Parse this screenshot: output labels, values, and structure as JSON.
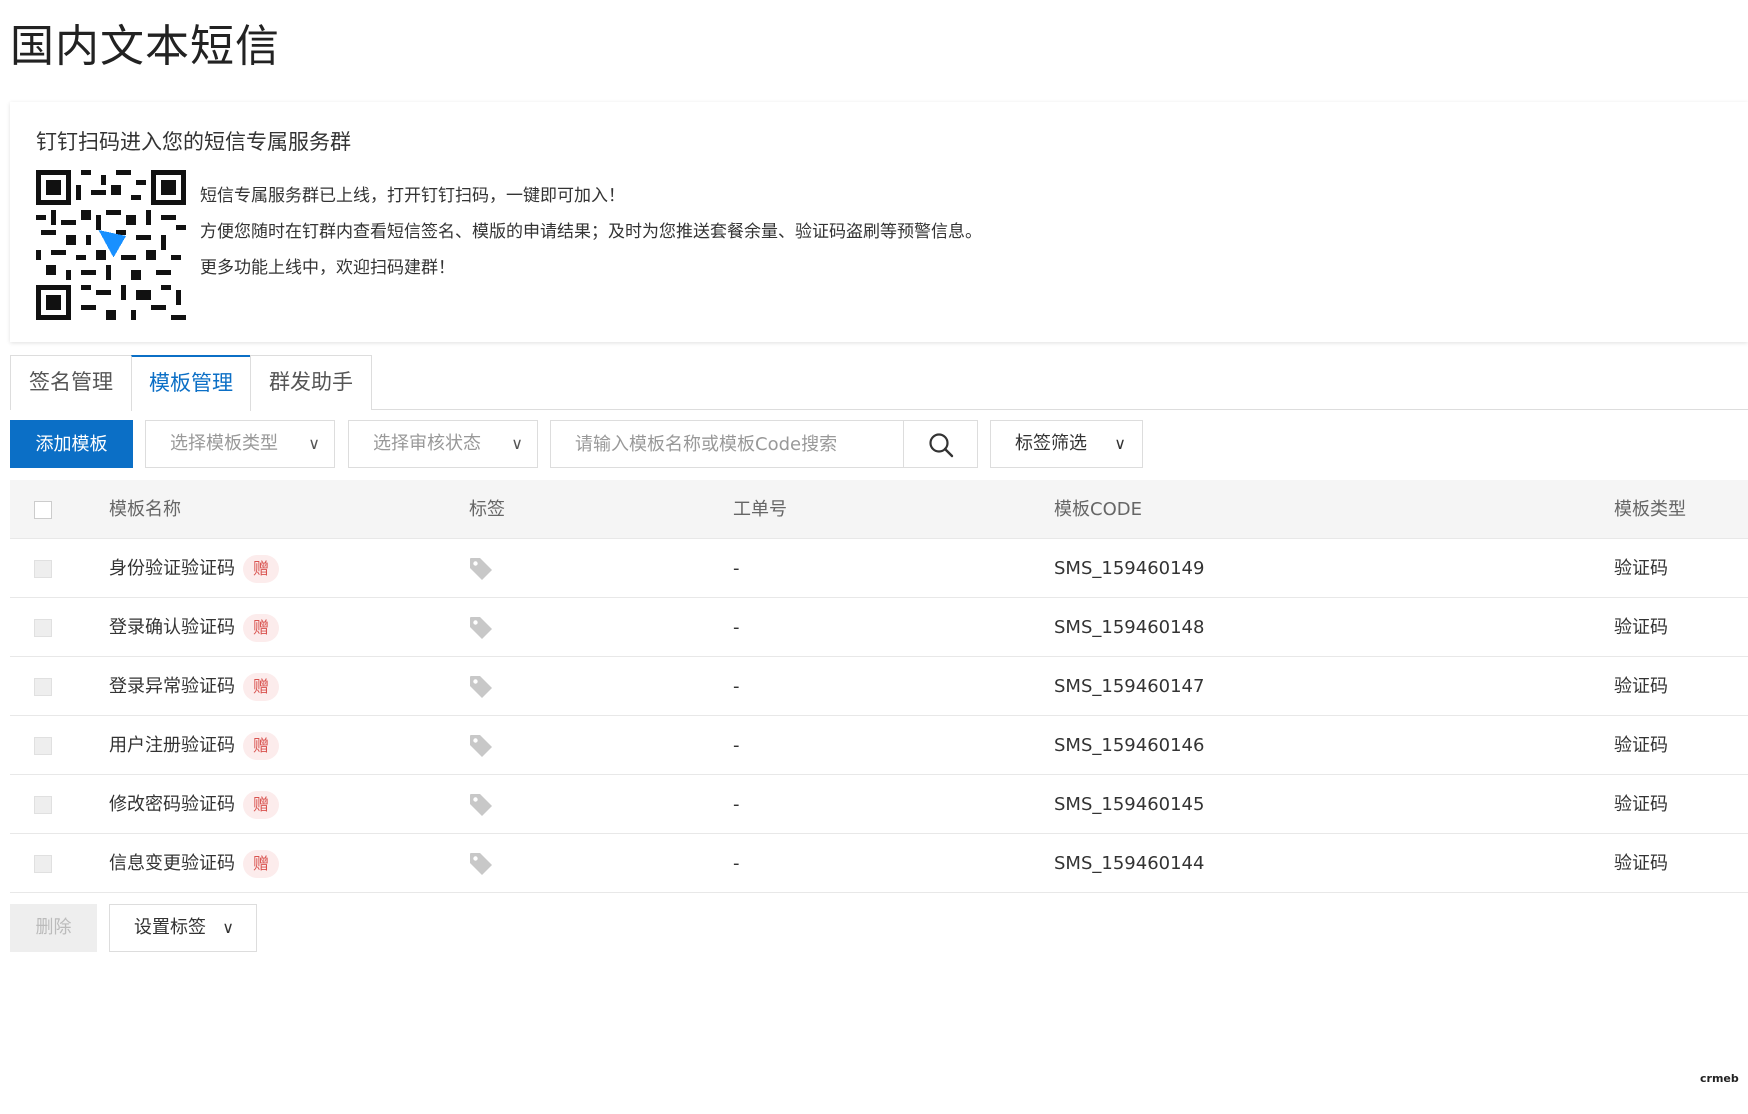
{
  "page": {
    "title": "国内文本短信"
  },
  "banner": {
    "title": "钉钉扫码进入您的短信专属服务群",
    "lines": [
      "短信专属服务群已上线，打开钉钉扫码，一键即可加入！",
      "方便您随时在钉群内查看短信签名、模版的申请结果；及时为您推送套餐余量、验证码盗刷等预警信息。",
      "更多功能上线中，欢迎扫码建群！"
    ]
  },
  "tabs": [
    {
      "label": "签名管理",
      "active": false
    },
    {
      "label": "模板管理",
      "active": true
    },
    {
      "label": "群发助手",
      "active": false
    }
  ],
  "toolbar": {
    "add_label": "添加模板",
    "type_select": "选择模板类型",
    "status_select": "选择审核状态",
    "search_placeholder": "请输入模板名称或模板Code搜索",
    "tag_filter": "标签筛选"
  },
  "table": {
    "headers": {
      "name": "模板名称",
      "tag": "标签",
      "ticket": "工单号",
      "code": "模板CODE",
      "type": "模板类型"
    },
    "gift_badge": "赠",
    "rows": [
      {
        "name": "身份验证验证码",
        "ticket": "-",
        "code": "SMS_159460149",
        "type": "验证码"
      },
      {
        "name": "登录确认验证码",
        "ticket": "-",
        "code": "SMS_159460148",
        "type": "验证码"
      },
      {
        "name": "登录异常验证码",
        "ticket": "-",
        "code": "SMS_159460147",
        "type": "验证码"
      },
      {
        "name": "用户注册验证码",
        "ticket": "-",
        "code": "SMS_159460146",
        "type": "验证码"
      },
      {
        "name": "修改密码验证码",
        "ticket": "-",
        "code": "SMS_159460145",
        "type": "验证码"
      },
      {
        "name": "信息变更验证码",
        "ticket": "-",
        "code": "SMS_159460144",
        "type": "验证码"
      }
    ]
  },
  "bottom": {
    "delete_label": "删除",
    "set_tag_label": "设置标签"
  },
  "icons": {
    "search": "search-icon",
    "chevron": "chevron-down-icon",
    "tag": "tag-icon",
    "qr": "qr-code-icon"
  },
  "colors": {
    "primary": "#0b6fc6",
    "gift_bg": "#fcecec",
    "gift_text": "#d9534f"
  },
  "watermark": "crmeb"
}
